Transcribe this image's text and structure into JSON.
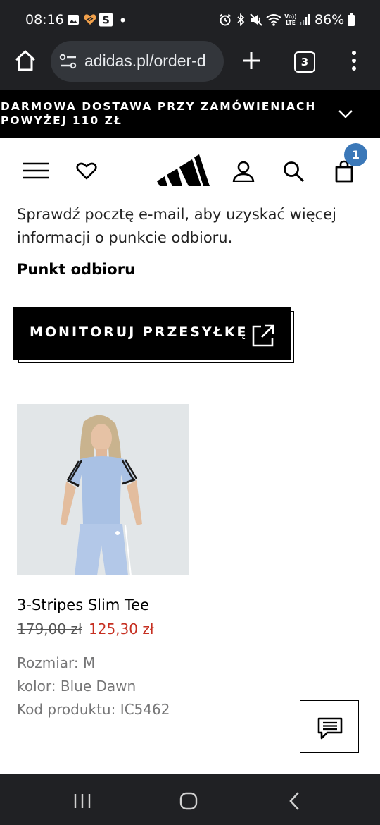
{
  "status_bar": {
    "time": "08:16",
    "battery": "86%",
    "icons": [
      "image-icon",
      "app-icon",
      "s-app-icon",
      "dot-icon",
      "alarm-icon",
      "bluetooth-icon",
      "mute-icon",
      "wifi-icon",
      "volte-icon",
      "signal-icon",
      "battery-icon"
    ]
  },
  "browser": {
    "url": "adidas.pl/order-d",
    "tabs_count": "3"
  },
  "promo": {
    "text": "DARMOWA DOSTAWA PRZY ZAMÓWIENIACH POWYŻEJ 110 ZŁ"
  },
  "header": {
    "cart_count": "1"
  },
  "content": {
    "info_text": "Sprawdź pocztę e-mail, aby uzyskać więcej informacji o punkcie odbioru.",
    "pickup_label": "Punkt odbioru",
    "track_button_label": "MONITORUJ PRZESYŁKĘ"
  },
  "product": {
    "name": "3-Stripes Slim Tee",
    "price_old": "179,00 zł",
    "price_new": "125,30 zł",
    "size": "Rozmiar: M",
    "color": "kolor: Blue Dawn",
    "code": "Kod produktu: IC5462"
  },
  "colors": {
    "sale_price": "#c62f21",
    "badge": "#3b78b8",
    "system_bar": "#202124"
  }
}
